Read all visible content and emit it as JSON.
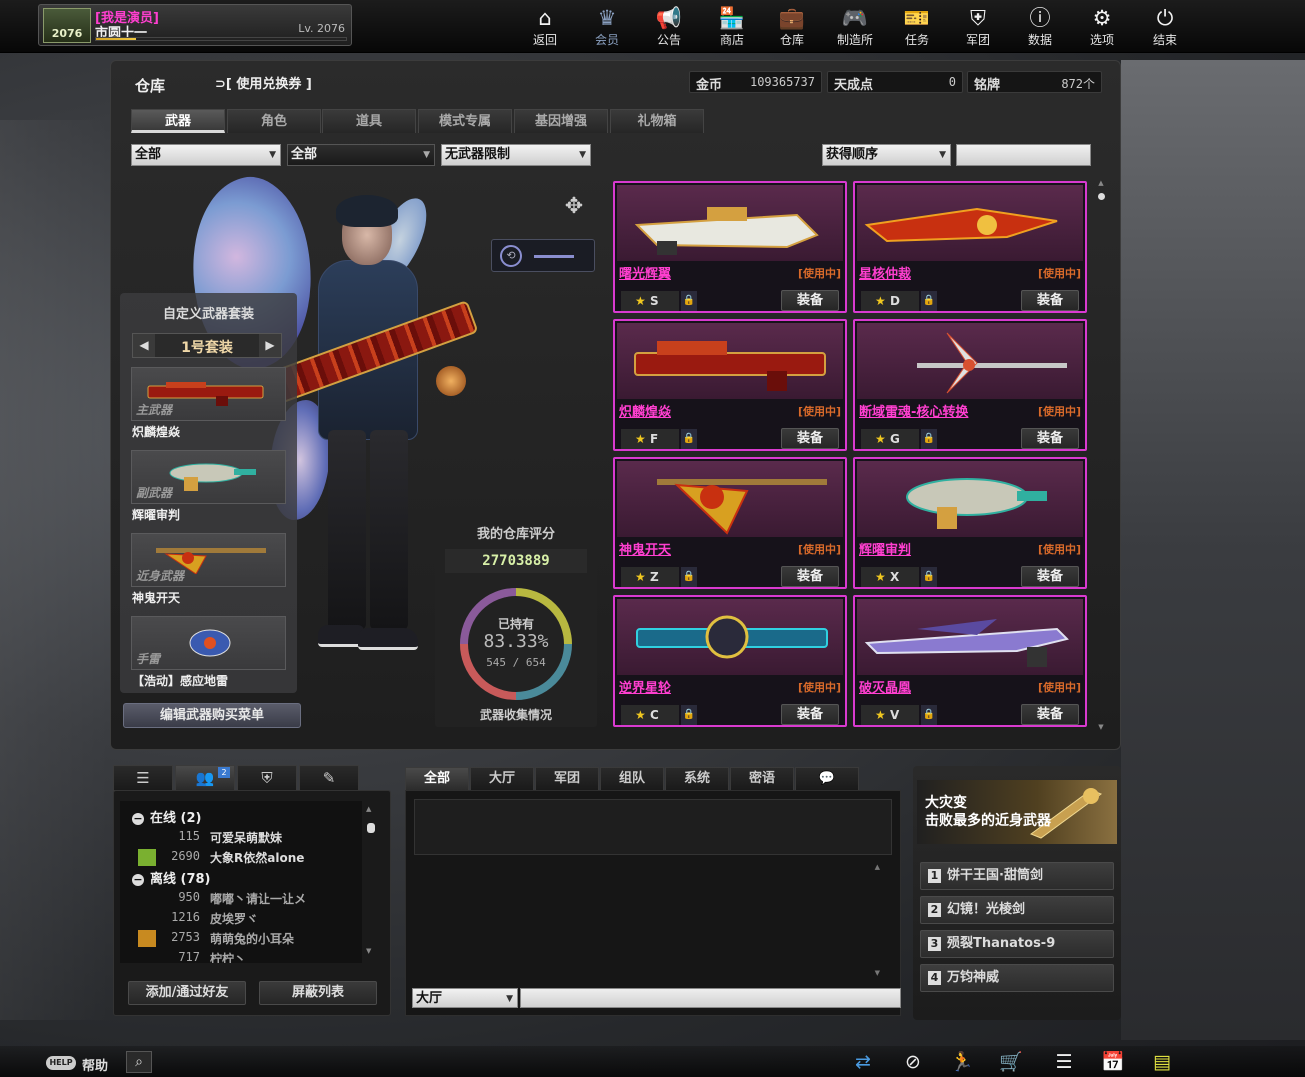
{
  "player": {
    "title": "[我是演员]",
    "name": "市圆十一",
    "level": "Lv. 2076",
    "emblem": "2076",
    "xp": 0.16
  },
  "nav": [
    {
      "label": "返回",
      "icon": "home-icon",
      "glyph": "⌂"
    },
    {
      "label": "会员",
      "icon": "crown-icon",
      "glyph": "♛"
    },
    {
      "label": "公告",
      "icon": "megaphone-icon",
      "glyph": "📢"
    },
    {
      "label": "商店",
      "icon": "shop-icon",
      "glyph": "🏪"
    },
    {
      "label": "仓库",
      "icon": "briefcase-icon",
      "glyph": "💼"
    },
    {
      "label": "制造所",
      "icon": "gamepad-icon",
      "glyph": "🎮"
    },
    {
      "label": "任务",
      "icon": "mission-icon",
      "glyph": "🎫"
    },
    {
      "label": "军团",
      "icon": "shield-icon",
      "glyph": "⛨"
    },
    {
      "label": "数据",
      "icon": "info-icon",
      "glyph": "ⓘ"
    },
    {
      "label": "选项",
      "icon": "gear-icon",
      "glyph": "⚙"
    },
    {
      "label": "结束",
      "icon": "power-icon",
      "glyph": "⏻"
    }
  ],
  "warehouse": {
    "title": "仓库",
    "voucher": "[ 使用兑换券 ]",
    "gold_label": "金币",
    "gold": "109365737",
    "points_label": "天成点",
    "points": "0",
    "medals_label": "铭牌",
    "medals": "872个"
  },
  "tabs": [
    "武器",
    "角色",
    "道具",
    "模式专属",
    "基因增强",
    "礼物箱"
  ],
  "filters": {
    "type": "全部",
    "sub": "全部",
    "limit": "无武器限制",
    "sort": "获得顺序"
  },
  "loadout": {
    "title": "自定义武器套装",
    "set_name": "1号套装",
    "slots": [
      {
        "tag": "主武器",
        "name": "炽麟煌焱"
      },
      {
        "tag": "副武器",
        "name": "辉曜审判"
      },
      {
        "tag": "近身武器",
        "name": "神鬼开天"
      },
      {
        "tag": "手雷",
        "name": "【浩动】感应地雷"
      }
    ],
    "edit_button": "编辑武器购买菜单"
  },
  "score": {
    "title": "我的仓库评分",
    "value": "27703889",
    "owned_label": "已持有",
    "percent": "83.33%",
    "count": "545 / 654",
    "label": "武器收集情况",
    "ratio": 0.8333
  },
  "weapons": [
    {
      "name": "曙光辉翼",
      "status": "[使用中]",
      "key": "S",
      "equip": "装备"
    },
    {
      "name": "星核仲裁",
      "status": "[使用中]",
      "key": "D",
      "equip": "装备"
    },
    {
      "name": "炽麟煌焱",
      "status": "[使用中]",
      "key": "F",
      "equip": "装备"
    },
    {
      "name": "断域雷魂-核心转换",
      "status": "[使用中]",
      "key": "G",
      "equip": "装备"
    },
    {
      "name": "神鬼开天",
      "status": "[使用中]",
      "key": "Z",
      "equip": "装备"
    },
    {
      "name": "辉曜审判",
      "status": "[使用中]",
      "key": "X",
      "equip": "装备"
    },
    {
      "name": "逆界星轮",
      "status": "[使用中]",
      "key": "C",
      "equip": "装备"
    },
    {
      "name": "破灭晶凰",
      "status": "[使用中]",
      "key": "V",
      "equip": "装备"
    }
  ],
  "friends": {
    "tab_badge": "2",
    "online_label": "在线 (2)",
    "offline_label": "离线 (78)",
    "online": [
      {
        "level": "115",
        "name": "可爱呆萌默妹"
      },
      {
        "level": "2690",
        "name": "大象R依然alone"
      }
    ],
    "offline": [
      {
        "level": "950",
        "name": "嘟嘟丶请让一让メ"
      },
      {
        "level": "1216",
        "name": "皮埃罗ヾ"
      },
      {
        "level": "2753",
        "name": "萌萌兔的小耳朵"
      },
      {
        "level": "717",
        "name": "柠柠丶"
      }
    ],
    "add_button": "添加/通过好友",
    "block_button": "屏蔽列表"
  },
  "chat": {
    "tabs": [
      "全部",
      "大厅",
      "军团",
      "组队",
      "系统",
      "密语"
    ],
    "channel": "大厅"
  },
  "news": {
    "title": "大灾变",
    "subtitle": "击败最多的近身武器",
    "ranks": [
      {
        "n": "1",
        "name": "饼干王国·甜筒剑"
      },
      {
        "n": "2",
        "name": "幻镜！光棱剑"
      },
      {
        "n": "3",
        "name": "殒裂Thanatos-9"
      },
      {
        "n": "4",
        "name": "万钧神威"
      }
    ]
  },
  "footer": {
    "help_badge": "HELP",
    "help": "帮助"
  },
  "colors": {
    "rarity_border": "#d93ad0",
    "weapon_name": "#ff3fd0",
    "in_use": "#d96a2a",
    "star": "#f0c820"
  }
}
